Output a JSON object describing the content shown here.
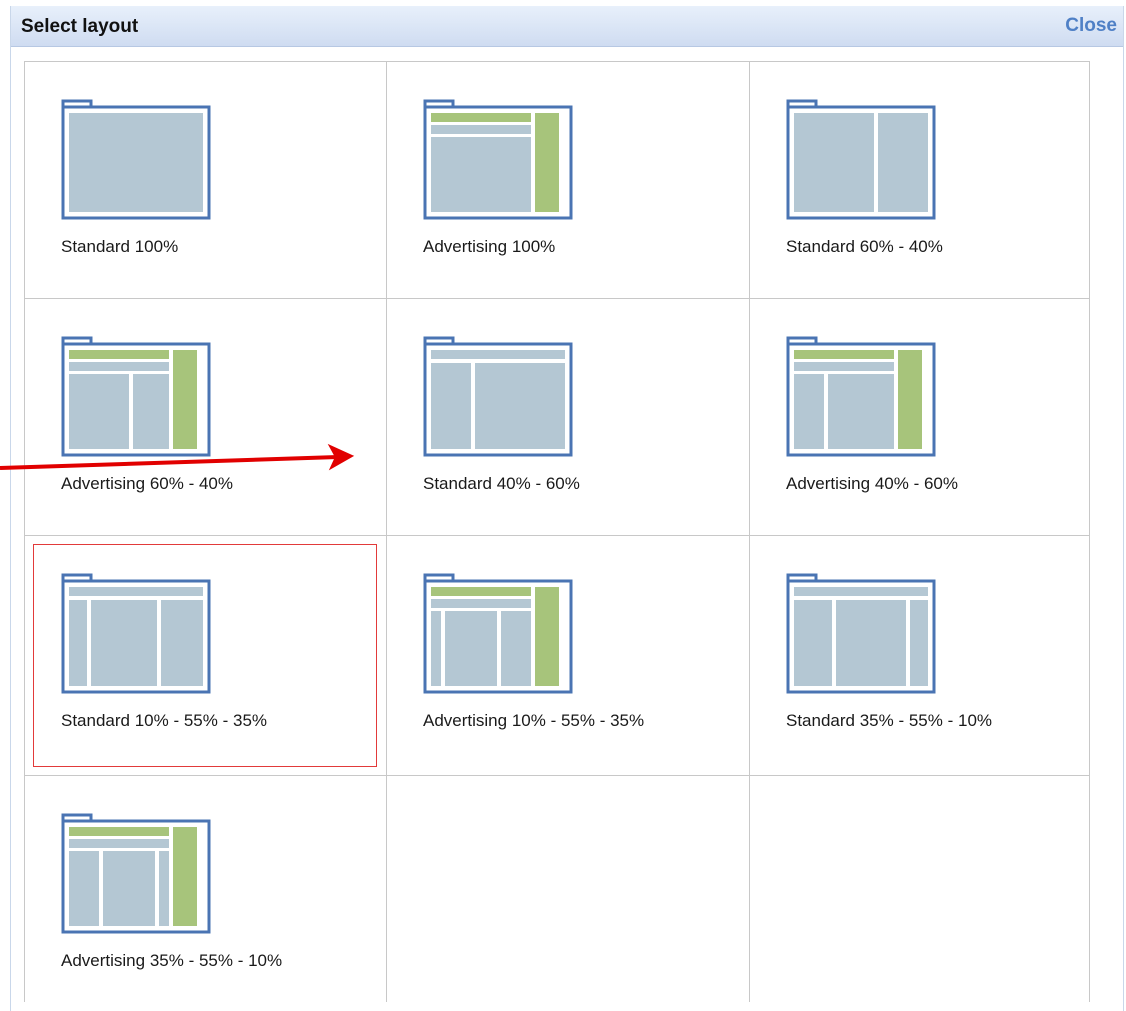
{
  "dialog": {
    "title": "Select layout",
    "close_label": "Close"
  },
  "layouts": [
    {
      "label": "Standard 100%",
      "icon": "layout-standard-100-icon"
    },
    {
      "label": "Advertising 100%",
      "icon": "layout-advertising-100-icon"
    },
    {
      "label": "Standard 60% - 40%",
      "icon": "layout-standard-60-40-icon"
    },
    {
      "label": "Advertising 60% - 40%",
      "icon": "layout-advertising-60-40-icon"
    },
    {
      "label": "Standard 40% - 60%",
      "icon": "layout-standard-40-60-icon"
    },
    {
      "label": "Advertising 40% - 60%",
      "icon": "layout-advertising-40-60-icon"
    },
    {
      "label": "Standard 10% - 55% - 35%",
      "icon": "layout-standard-10-55-35-icon",
      "selected": true
    },
    {
      "label": "Advertising 10% - 55% - 35%",
      "icon": "layout-advertising-10-55-35-icon"
    },
    {
      "label": "Standard 35% - 55% - 10%",
      "icon": "layout-standard-35-55-10-icon"
    },
    {
      "label": "Advertising 35% - 55% - 10%",
      "icon": "layout-advertising-35-55-10-icon"
    }
  ],
  "colors": {
    "frame": "#4a74b3",
    "panel": "#b4c7d3",
    "ad": "#a7c47b",
    "selection": "#e23a3a",
    "annotation_arrow": "#e10000"
  }
}
